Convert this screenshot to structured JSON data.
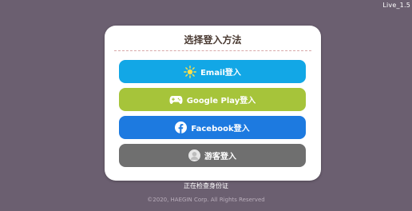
{
  "version": "Live_1.5",
  "dialog": {
    "title": "选择登入方法"
  },
  "buttons": [
    {
      "label": "Email登入",
      "icon": "sun-icon",
      "color": "#12a7e6"
    },
    {
      "label": "Google Play登入",
      "icon": "gamepad-icon",
      "color": "#a6c43a"
    },
    {
      "label": "Facebook登入",
      "icon": "facebook-icon",
      "color": "#1d7ae0"
    },
    {
      "label": "游客登入",
      "icon": "guest-avatar-icon",
      "color": "#6f6f6f"
    }
  ],
  "status": "正在检查身份证",
  "copyright": "©2020, HAEGIN Corp. All Rights Reserved"
}
